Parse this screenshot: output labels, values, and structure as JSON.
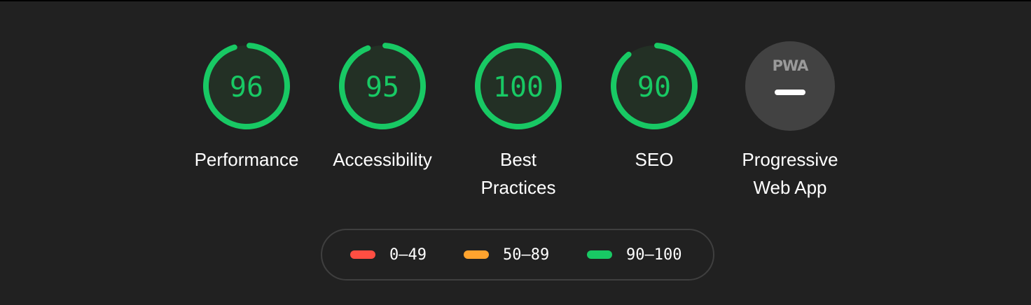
{
  "colors": {
    "background": "#212121",
    "pass": "#18c964",
    "average": "#ffa32e",
    "fail": "#ff4e42",
    "gauge_fill": "#233025",
    "pwa_bg": "#424242"
  },
  "categories": [
    {
      "id": "performance",
      "label": "Performance",
      "score": "96",
      "fraction": 0.96
    },
    {
      "id": "accessibility",
      "label": "Accessibility",
      "score": "95",
      "fraction": 0.95
    },
    {
      "id": "best-practices",
      "label": "Best Practices",
      "score": "100",
      "fraction": 1.0
    },
    {
      "id": "seo",
      "label": "SEO",
      "score": "90",
      "fraction": 0.9
    }
  ],
  "pwa": {
    "logo_text": "PWA",
    "label": "Progressive Web App",
    "icon": "pwa-logo-icon"
  },
  "legend": [
    {
      "range": "0–49",
      "color": "#ff4e42"
    },
    {
      "range": "50–89",
      "color": "#ffa32e"
    },
    {
      "range": "90–100",
      "color": "#18c964"
    }
  ]
}
